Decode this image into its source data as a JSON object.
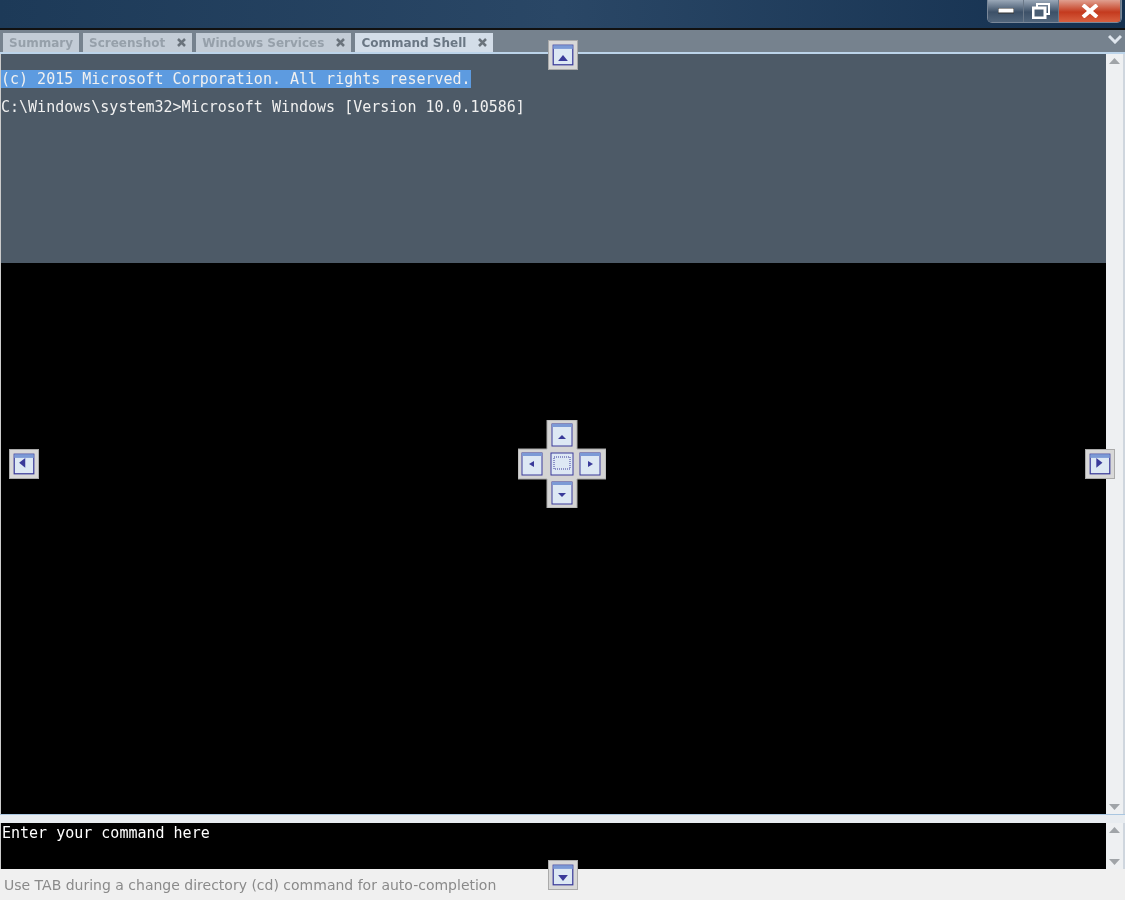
{
  "tabs": [
    {
      "label": "Summary",
      "closable": false,
      "selected": false
    },
    {
      "label": "Screenshot",
      "closable": true,
      "selected": false
    },
    {
      "label": "Windows Services",
      "closable": true,
      "selected": false
    },
    {
      "label": "Command Shell",
      "closable": true,
      "selected": true
    }
  ],
  "console": {
    "lines": [
      {
        "text": "(c) 2015 Microsoft Corporation. All rights reserved.",
        "selected": true
      },
      {
        "text": "C:\\Windows\\system32>Microsoft Windows [Version 10.0.10586]",
        "selected": false
      }
    ]
  },
  "command_input": {
    "placeholder": "Enter your command here"
  },
  "status_bar": "Use TAB during a change directory (cd) command for auto-completion"
}
